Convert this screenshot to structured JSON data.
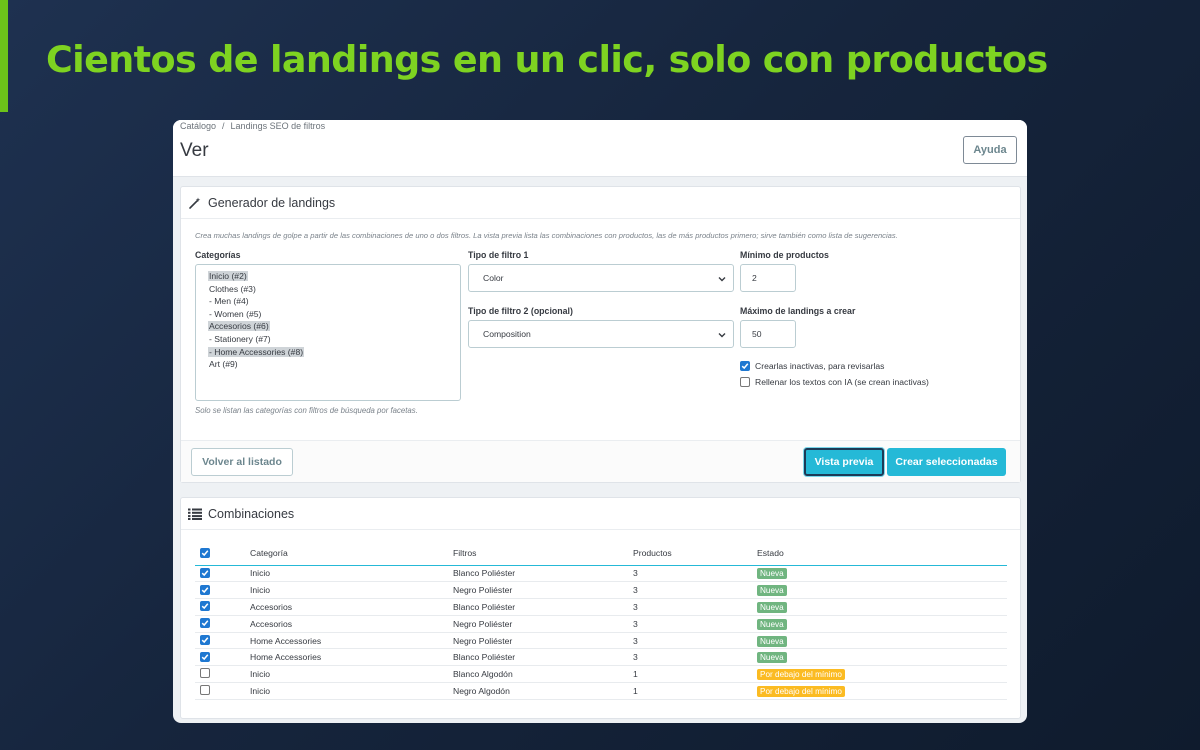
{
  "headline": "Cientos de landings en un clic, solo con productos",
  "breadcrumb": {
    "root": "Catálogo",
    "separator": "/",
    "current": "Landings SEO de filtros"
  },
  "page_title": "Ver",
  "help_button": "Ayuda",
  "generator": {
    "title": "Generador de landings",
    "intro": "Crea muchas landings de golpe a partir de las combinaciones de uno o dos filtros. La vista previa lista las combinaciones con productos, las de más productos primero; sirve también como lista de sugerencias.",
    "categories_label": "Categorías",
    "categories": [
      {
        "label": "Inicio (#2)",
        "selected": true
      },
      {
        "label": "Clothes (#3)",
        "selected": false
      },
      {
        "label": "- Men (#4)",
        "selected": false
      },
      {
        "label": "- Women (#5)",
        "selected": false
      },
      {
        "label": "Accesorios (#6)",
        "selected": true
      },
      {
        "label": "- Stationery (#7)",
        "selected": false
      },
      {
        "label": "- Home Accessories (#8)",
        "selected": true
      },
      {
        "label": "Art (#9)",
        "selected": false
      }
    ],
    "categories_help": "Solo se listan las categorías con filtros de búsqueda por facetas.",
    "filter1_label": "Tipo de filtro 1",
    "filter1_value": "Color",
    "filter2_label": "Tipo de filtro 2 (opcional)",
    "filter2_value": "Composition",
    "min_label": "Mínimo de productos",
    "min_value": "2",
    "max_label": "Máximo de landings a crear",
    "max_value": "50",
    "option_inactive": "Crearlas inactivas, para revisarlas",
    "option_inactive_checked": true,
    "option_ai": "Rellenar los textos con IA (se crean inactivas)",
    "option_ai_checked": false,
    "back_button": "Volver al listado",
    "preview_button": "Vista previa",
    "create_button": "Crear seleccionadas"
  },
  "combinations": {
    "title": "Combinaciones",
    "columns": [
      "Categoría",
      "Filtros",
      "Productos",
      "Estado"
    ],
    "rows": [
      {
        "checked": true,
        "category": "Inicio",
        "filters": "Blanco Poliéster",
        "products": "3",
        "status": "Nueva",
        "status_type": "nueva"
      },
      {
        "checked": true,
        "category": "Inicio",
        "filters": "Negro Poliéster",
        "products": "3",
        "status": "Nueva",
        "status_type": "nueva"
      },
      {
        "checked": true,
        "category": "Accesorios",
        "filters": "Blanco Poliéster",
        "products": "3",
        "status": "Nueva",
        "status_type": "nueva"
      },
      {
        "checked": true,
        "category": "Accesorios",
        "filters": "Negro Poliéster",
        "products": "3",
        "status": "Nueva",
        "status_type": "nueva"
      },
      {
        "checked": true,
        "category": "Home Accessories",
        "filters": "Negro Poliéster",
        "products": "3",
        "status": "Nueva",
        "status_type": "nueva"
      },
      {
        "checked": true,
        "category": "Home Accessories",
        "filters": "Blanco Poliéster",
        "products": "3",
        "status": "Nueva",
        "status_type": "nueva"
      },
      {
        "checked": false,
        "category": "Inicio",
        "filters": "Blanco Algodón",
        "products": "1",
        "status": "Por debajo del mínimo",
        "status_type": "below"
      },
      {
        "checked": false,
        "category": "Inicio",
        "filters": "Negro Algodón",
        "products": "1",
        "status": "Por debajo del mínimo",
        "status_type": "below"
      }
    ]
  },
  "colors": {
    "accent": "#7ed321",
    "primary": "#25b9d7",
    "badge_new": "#70b580",
    "badge_below": "#fbbb22"
  }
}
